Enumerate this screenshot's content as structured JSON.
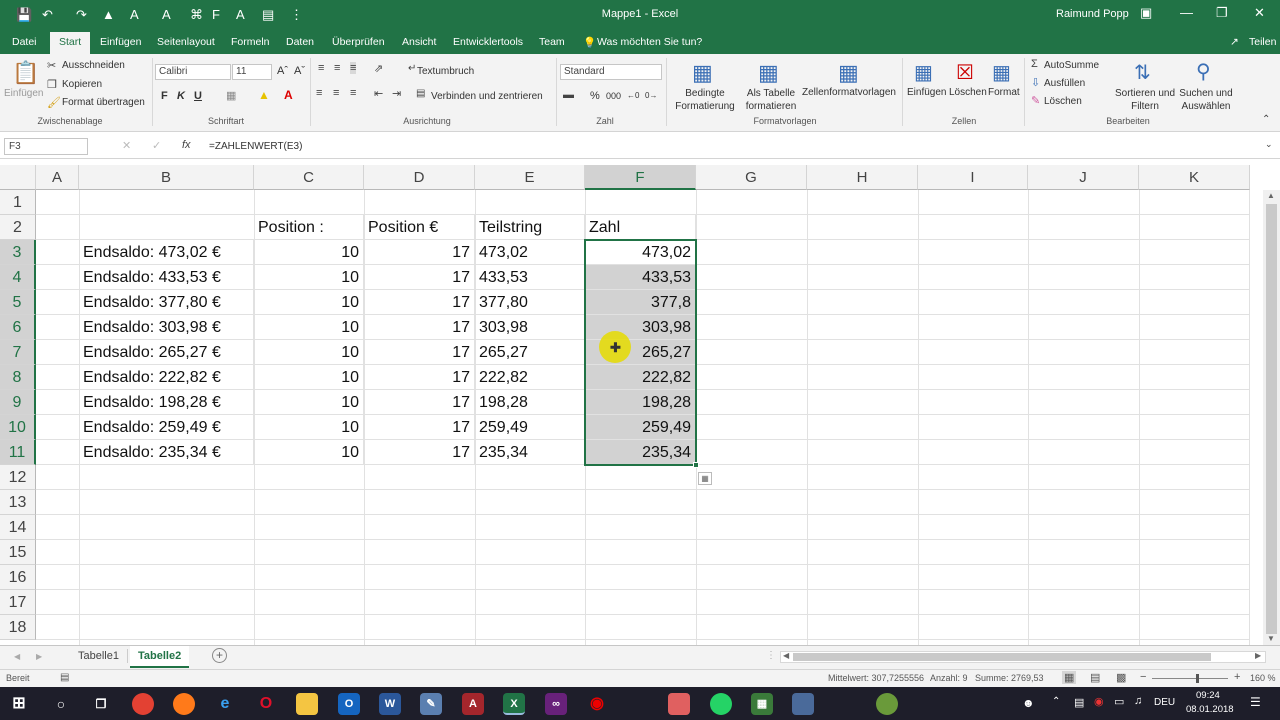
{
  "window": {
    "title": "Mappe1 - Excel",
    "user": "Raimund Popp"
  },
  "tabs": [
    "Datei",
    "Start",
    "Einfügen",
    "Seitenlayout",
    "Formeln",
    "Daten",
    "Überprüfen",
    "Ansicht",
    "Entwicklertools",
    "Team"
  ],
  "tell_me": "Was möchten Sie tun?",
  "share": "Teilen",
  "ribbon": {
    "clipboard": {
      "paste": "Einfügen",
      "cut": "Ausschneiden",
      "copy": "Kopieren",
      "format_painter": "Format übertragen",
      "group": "Zwischenablage"
    },
    "font": {
      "name": "Calibri",
      "size": "11",
      "bold": "F",
      "italic": "K",
      "underline": "U",
      "group": "Schriftart"
    },
    "alignment": {
      "wrap": "Textumbruch",
      "merge": "Verbinden und zentrieren",
      "group": "Ausrichtung"
    },
    "number": {
      "format": "Standard",
      "group": "Zahl"
    },
    "styles": {
      "conditional": "Bedingte Formatierung",
      "as_table": "Als Tabelle formatieren",
      "cell_styles": "Zellenformatvorlagen",
      "group": "Formatvorlagen"
    },
    "cells": {
      "insert": "Einfügen",
      "delete": "Löschen",
      "format": "Format",
      "group": "Zellen"
    },
    "editing": {
      "autosum": "AutoSumme",
      "fill": "Ausfüllen",
      "clear": "Löschen",
      "sort": "Sortieren und Filtern",
      "find": "Suchen und Auswählen",
      "group": "Bearbeiten"
    }
  },
  "formula_bar": {
    "name_box": "F3",
    "formula": "=ZAHLENWERT(E3)"
  },
  "grid": {
    "columns": [
      "A",
      "B",
      "C",
      "D",
      "E",
      "F",
      "G",
      "H",
      "I",
      "J",
      "K"
    ],
    "rows": [
      "1",
      "2",
      "3",
      "4",
      "5",
      "6",
      "7",
      "8",
      "9",
      "10",
      "11",
      "12",
      "13",
      "14",
      "15",
      "16",
      "17",
      "18"
    ],
    "selected_column": "F",
    "headers": {
      "C": "Position :",
      "D": "Position €",
      "E": "Teilstring",
      "F": "Zahl"
    },
    "data": [
      {
        "b": "Endsaldo: 473,02 €",
        "c": "10",
        "d": "17",
        "e": "473,02",
        "f": "473,02"
      },
      {
        "b": "Endsaldo: 433,53 €",
        "c": "10",
        "d": "17",
        "e": "433,53",
        "f": "433,53"
      },
      {
        "b": "Endsaldo: 377,80 €",
        "c": "10",
        "d": "17",
        "e": "377,80",
        "f": "377,8"
      },
      {
        "b": "Endsaldo: 303,98 €",
        "c": "10",
        "d": "17",
        "e": "303,98",
        "f": "303,98"
      },
      {
        "b": "Endsaldo: 265,27 €",
        "c": "10",
        "d": "17",
        "e": "265,27",
        "f": "265,27"
      },
      {
        "b": "Endsaldo: 222,82 €",
        "c": "10",
        "d": "17",
        "e": "222,82",
        "f": "222,82"
      },
      {
        "b": "Endsaldo: 198,28 €",
        "c": "10",
        "d": "17",
        "e": "198,28",
        "f": "198,28"
      },
      {
        "b": "Endsaldo: 259,49 €",
        "c": "10",
        "d": "17",
        "e": "259,49",
        "f": "259,49"
      },
      {
        "b": "Endsaldo: 235,34 €",
        "c": "10",
        "d": "17",
        "e": "235,34",
        "f": "235,34"
      }
    ]
  },
  "sheets": [
    "Tabelle1",
    "Tabelle2"
  ],
  "active_sheet": "Tabelle2",
  "status": {
    "ready": "Bereit",
    "average": "Mittelwert: 307,7255556",
    "count": "Anzahl: 9",
    "sum": "Summe: 2769,53",
    "zoom": "160 %"
  },
  "taskbar": {
    "lang": "DEU",
    "time": "09:24",
    "date": "08.01.2018"
  },
  "colors": {
    "excel_green": "#217346",
    "selection_gray": "#d2d2d2"
  }
}
